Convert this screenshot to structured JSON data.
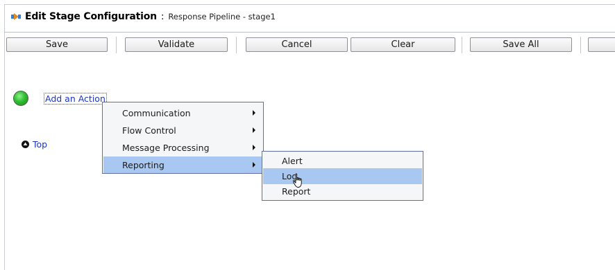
{
  "title": {
    "main": "Edit Stage Configuration",
    "separator": ":",
    "sub": "Response Pipeline - stage1",
    "icon": "stage-config-icon"
  },
  "toolbar": {
    "save_label": "Save",
    "validate_label": "Validate",
    "cancel_label": "Cancel",
    "clear_label": "Clear",
    "save_all_label": "Save All"
  },
  "stage": {
    "status_icon": "green-status-icon",
    "add_action_label": "Add an Action",
    "top_label": "Top",
    "top_icon": "up-arrow-circle-icon"
  },
  "menu": {
    "items": [
      {
        "label": "Communication"
      },
      {
        "label": "Flow Control"
      },
      {
        "label": "Message Processing"
      },
      {
        "label": "Reporting"
      }
    ],
    "active_item": "Reporting"
  },
  "submenu": {
    "items": [
      {
        "label": "Alert"
      },
      {
        "label": "Log"
      },
      {
        "label": "Report"
      }
    ],
    "hovered_item": "Log"
  },
  "colors": {
    "menu_highlight": "#a8c8f2",
    "menu_border": "#5f6fa3",
    "link": "#1a34c4",
    "status_green": "#2fbf2f"
  }
}
